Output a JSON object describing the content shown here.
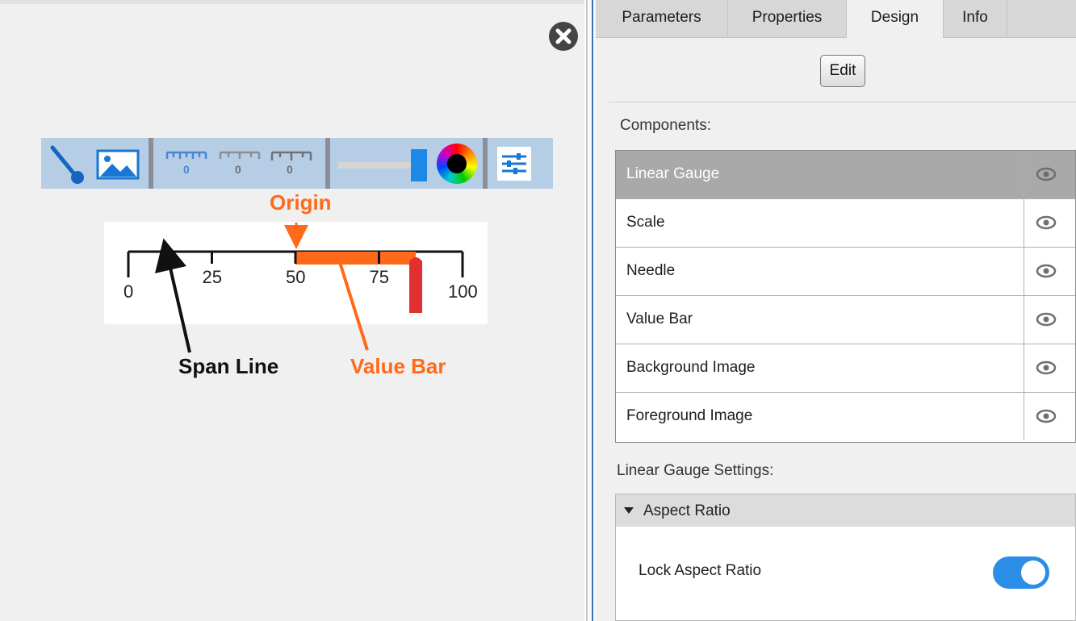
{
  "gauge": {
    "ticks": [
      {
        "value": 0,
        "label": "0"
      },
      {
        "value": 25,
        "label": "25"
      },
      {
        "value": 50,
        "label": "50"
      },
      {
        "value": 75,
        "label": "75"
      },
      {
        "value": 100,
        "label": "100"
      }
    ],
    "origin_value": 50,
    "needle_value": 86,
    "value_bar_color": "#ff6a1a",
    "needle_color": "#e03030"
  },
  "annotations": {
    "origin": "Origin",
    "span_line": "Span Line",
    "value_bar": "Value Bar",
    "orange_color": "#ff6a1a"
  },
  "toolbar": {
    "items": [
      "needle-icon",
      "background-image-icon",
      "scale-style-1-icon",
      "scale-style-2-icon",
      "scale-style-3-icon",
      "value-bar-icon",
      "color-picker-icon",
      "settings-sliders-icon"
    ]
  },
  "tabs": [
    {
      "label": "Parameters",
      "active": false
    },
    {
      "label": "Properties",
      "active": false
    },
    {
      "label": "Design",
      "active": true
    },
    {
      "label": "Info",
      "active": false
    }
  ],
  "panel": {
    "edit_label": "Edit",
    "components_label": "Components:",
    "components": [
      {
        "label": "Linear Gauge",
        "selected": true
      },
      {
        "label": "Scale",
        "selected": false
      },
      {
        "label": "Needle",
        "selected": false
      },
      {
        "label": "Value Bar",
        "selected": false
      },
      {
        "label": "Background Image",
        "selected": false
      },
      {
        "label": "Foreground Image",
        "selected": false
      }
    ],
    "settings_label": "Linear Gauge Settings:",
    "aspect_section": "Aspect Ratio",
    "lock_label": "Lock Aspect Ratio",
    "lock_on": true,
    "accent_color": "#2b8de6"
  }
}
